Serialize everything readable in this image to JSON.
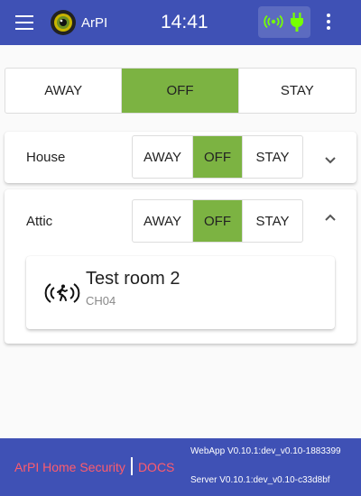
{
  "toolbar": {
    "app_name": "ArPI",
    "clock": "14:41",
    "icons": [
      "menu-icon",
      "logo-eye-icon",
      "syren-signal-icon",
      "power-plug-icon",
      "more-vert-icon"
    ],
    "colors": {
      "background": "#3f51b5",
      "status_box": "#5c6bc0",
      "status_icon": "#76ff03"
    }
  },
  "global_arm": {
    "options": [
      "AWAY",
      "OFF",
      "STAY"
    ],
    "selected": "OFF",
    "active_color": "#7cb342"
  },
  "areas": [
    {
      "name": "House",
      "options": [
        "AWAY",
        "OFF",
        "STAY"
      ],
      "selected": "OFF",
      "expanded": false,
      "chevron_icon": "chevron-down-icon"
    },
    {
      "name": "Attic",
      "options": [
        "AWAY",
        "OFF",
        "STAY"
      ],
      "selected": "OFF",
      "expanded": true,
      "chevron_icon": "chevron-up-icon",
      "zones": [
        {
          "name": "Test room 2",
          "channel": "CH04",
          "icon": "motion-sensor-icon"
        }
      ]
    }
  ],
  "footer": {
    "home_link": "ArPI Home Security",
    "docs_link": "DOCS",
    "webapp_version": "WebApp V0.10.1:dev_v0.10-1883399",
    "server_version": "Server V0.10.1:dev_v0.10-c33d8bf",
    "link_color": "#ff5c6c"
  }
}
